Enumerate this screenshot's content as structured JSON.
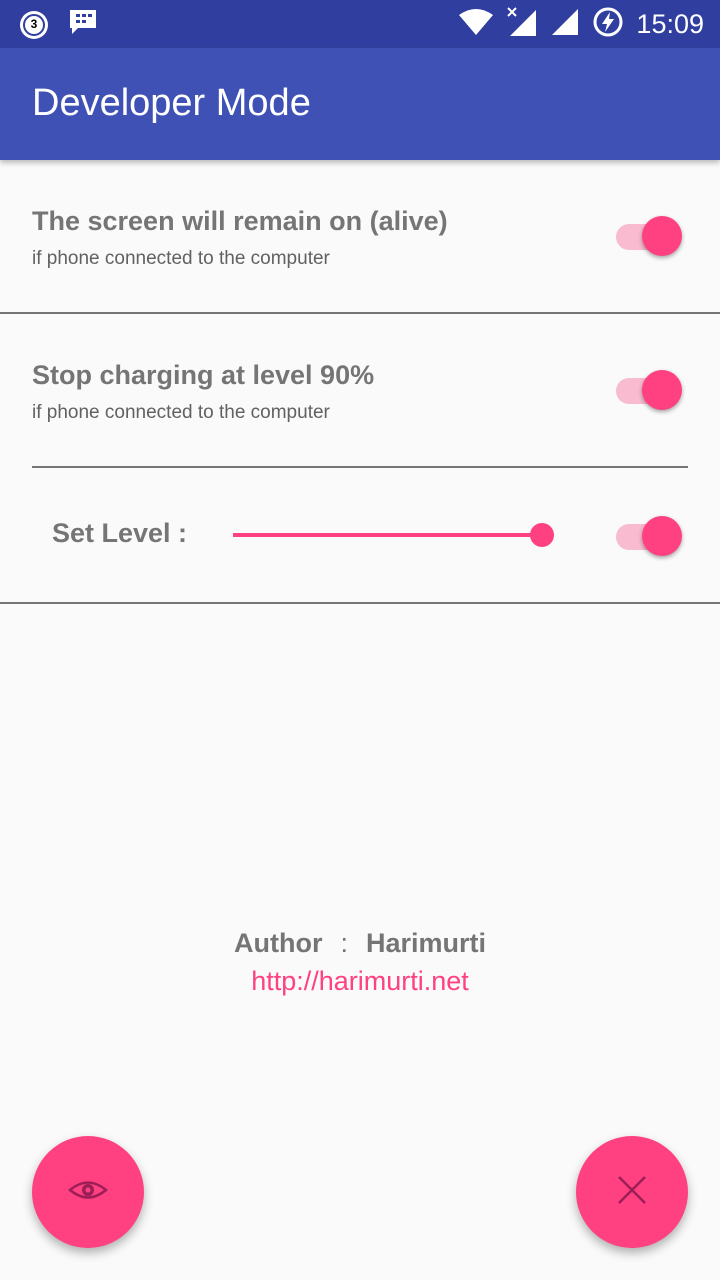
{
  "status_bar": {
    "notification_badge": "3",
    "time": "15:09"
  },
  "app_bar": {
    "title": "Developer Mode"
  },
  "settings": [
    {
      "title": "The screen will remain on (alive)",
      "subtitle": "if phone connected to the computer",
      "enabled": true
    },
    {
      "title": "Stop charging at level 90%",
      "subtitle": "if phone connected to the computer",
      "enabled": true
    }
  ],
  "level": {
    "label": "Set Level :",
    "slider_fraction": 1.0,
    "enabled": true
  },
  "author": {
    "label": "Author",
    "separator": ":",
    "name": "Harimurti",
    "link": "http://harimurti.net"
  },
  "colors": {
    "primary": "#3f51b5",
    "primary_dark": "#303f9f",
    "accent": "#ff4081"
  },
  "fabs": {
    "left_icon": "eye-icon",
    "right_icon": "close-icon"
  }
}
